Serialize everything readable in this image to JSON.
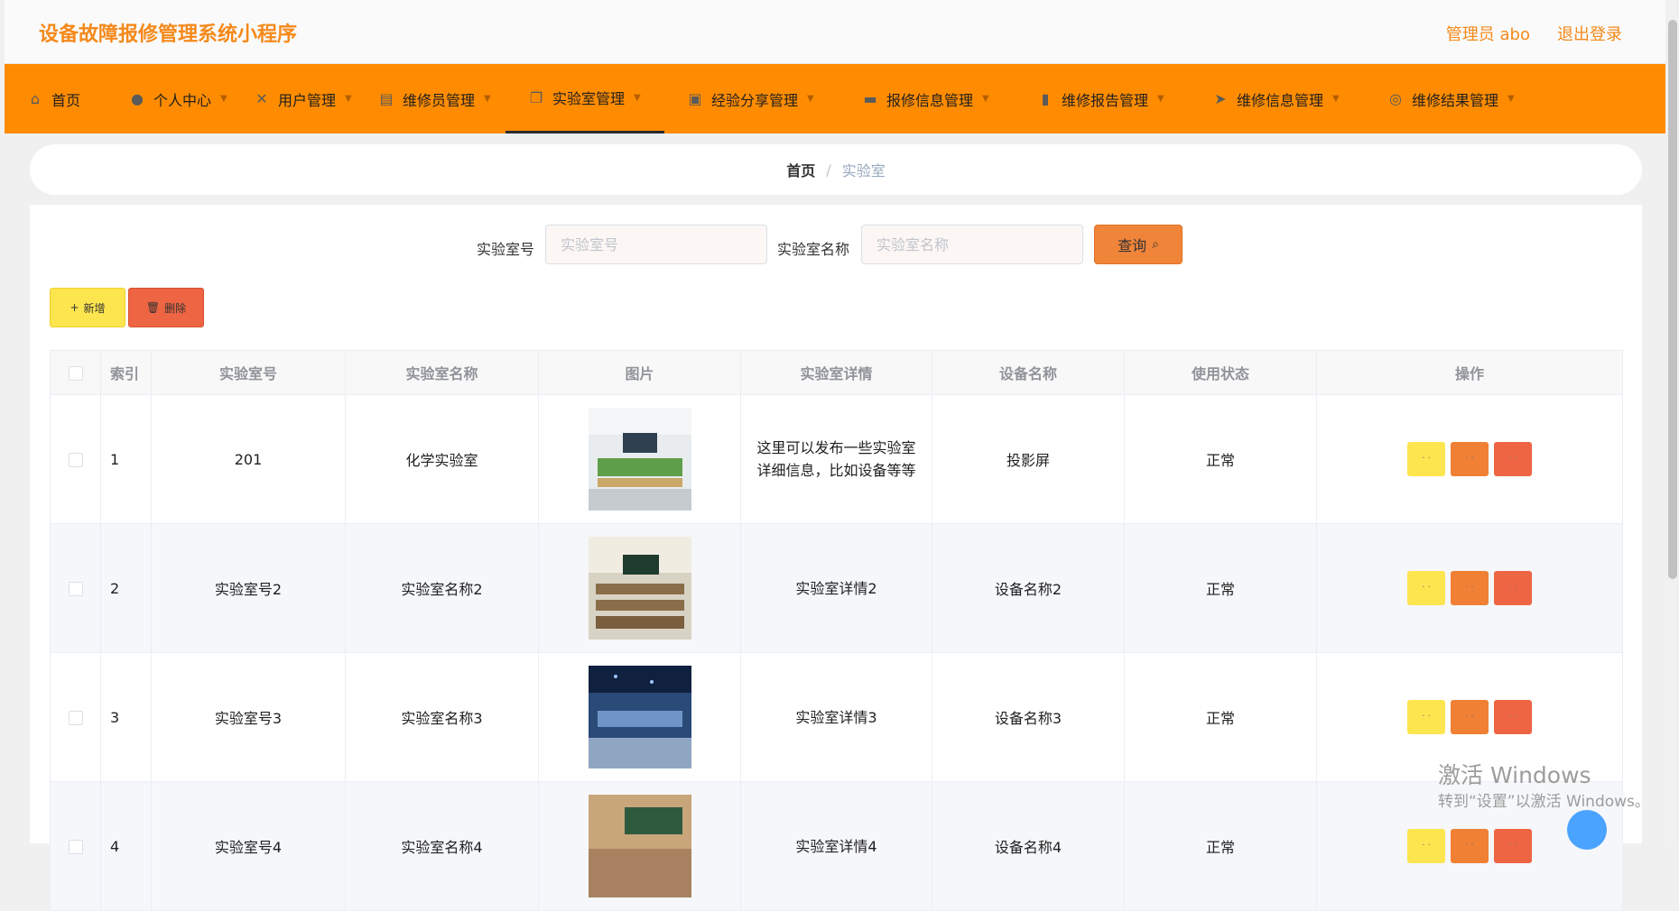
{
  "header": {
    "app_title": "设备故障报修管理系统小程序",
    "user_label": "管理员 abo",
    "logout_label": "退出登录",
    "accent_color": "#ff8c00"
  },
  "nav": {
    "items": [
      {
        "label": "首页",
        "icon": "home-icon",
        "has_dropdown": false,
        "active": false
      },
      {
        "label": "个人中心",
        "icon": "user-icon",
        "has_dropdown": true,
        "active": false
      },
      {
        "label": "用户管理",
        "icon": "users-icon",
        "has_dropdown": true,
        "active": false
      },
      {
        "label": "维修员管理",
        "icon": "clipboard-icon",
        "has_dropdown": true,
        "active": false
      },
      {
        "label": "实验室管理",
        "icon": "copy-icon",
        "has_dropdown": true,
        "active": true
      },
      {
        "label": "经验分享管理",
        "icon": "clipboard-check-icon",
        "has_dropdown": true,
        "active": false
      },
      {
        "label": "报修信息管理",
        "icon": "monitor-icon",
        "has_dropdown": true,
        "active": false
      },
      {
        "label": "维修报告管理",
        "icon": "bar-chart-icon",
        "has_dropdown": true,
        "active": false
      },
      {
        "label": "维修信息管理",
        "icon": "send-icon",
        "has_dropdown": true,
        "active": false
      },
      {
        "label": "维修结果管理",
        "icon": "compass-icon",
        "has_dropdown": true,
        "active": false
      }
    ]
  },
  "breadcrumb": {
    "home": "首页",
    "separator": "/",
    "current": "实验室"
  },
  "search": {
    "room_no_label": "实验室号",
    "room_no_placeholder": "实验室号",
    "room_name_label": "实验室名称",
    "room_name_placeholder": "实验室名称",
    "query_label": "查询"
  },
  "actions": {
    "add_label": "新增",
    "delete_label": "删除"
  },
  "table": {
    "headers": {
      "index": "索引",
      "room_no": "实验室号",
      "room_name": "实验室名称",
      "image": "图片",
      "detail": "实验室详情",
      "device": "设备名称",
      "status": "使用状态",
      "ops": "操作"
    },
    "rows": [
      {
        "index": "1",
        "room_no": "201",
        "room_name": "化学实验室",
        "detail": "这里可以发布一些实验室详细信息，比如设备等等",
        "device": "投影屏",
        "status": "正常"
      },
      {
        "index": "2",
        "room_no": "实验室号2",
        "room_name": "实验室名称2",
        "detail": "实验室详情2",
        "device": "设备名称2",
        "status": "正常"
      },
      {
        "index": "3",
        "room_no": "实验室号3",
        "room_name": "实验室名称3",
        "detail": "实验室详情3",
        "device": "设备名称3",
        "status": "正常"
      },
      {
        "index": "4",
        "room_no": "实验室号4",
        "room_name": "实验室名称4",
        "detail": "实验室详情4",
        "device": "设备名称4",
        "status": "正常"
      }
    ]
  },
  "os_watermark": {
    "line1": "激活 Windows",
    "line2": "转到“设置”以激活 Windows。"
  }
}
